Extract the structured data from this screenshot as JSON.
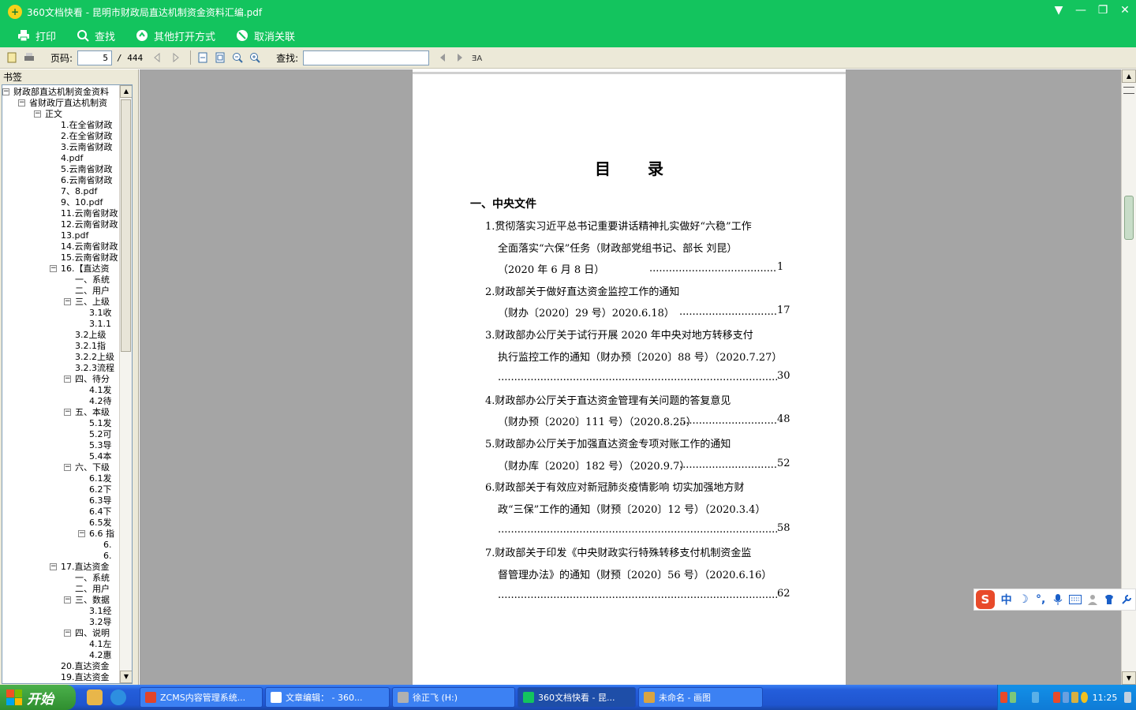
{
  "window": {
    "title": "360文档快看 - 昆明市财政局直达机制资金资料汇编.pdf",
    "controls": [
      "▼",
      "—",
      "❐",
      "✕"
    ]
  },
  "green_toolbar": {
    "print": "打印",
    "find": "查找",
    "open_with": "其他打开方式",
    "unlink": "取消关联"
  },
  "viewer_toolbar": {
    "page_label": "页码:",
    "page_current": "5",
    "page_total": "/ 444",
    "search_label": "查找:",
    "search_value": ""
  },
  "sidebar": {
    "header": "书签",
    "tree": [
      {
        "label": "财政部直达机制资金资料",
        "level": 0,
        "toggle": "−"
      },
      {
        "label": "省财政厅直达机制资",
        "level": 1,
        "toggle": "−"
      },
      {
        "label": "正文",
        "level": 2,
        "toggle": "−"
      },
      {
        "label": "1.在全省财政",
        "level": 3
      },
      {
        "label": "2.在全省财政",
        "level": 3
      },
      {
        "label": "3.云南省财政",
        "level": 3
      },
      {
        "label": "4.pdf",
        "level": 3
      },
      {
        "label": "5.云南省财政",
        "level": 3
      },
      {
        "label": "6.云南省财政",
        "level": 3
      },
      {
        "label": "7、8.pdf",
        "level": 3
      },
      {
        "label": "9、10.pdf",
        "level": 3
      },
      {
        "label": "11.云南省财政",
        "level": 3
      },
      {
        "label": "12.云南省财政",
        "level": 3
      },
      {
        "label": "13.pdf",
        "level": 3
      },
      {
        "label": "14.云南省财政",
        "level": 3
      },
      {
        "label": "15.云南省财政",
        "level": 3
      },
      {
        "label": "16.【直达资",
        "level": 3,
        "toggle": "−"
      },
      {
        "label": "一、系统",
        "level": 4
      },
      {
        "label": "二、用户",
        "level": 4
      },
      {
        "label": "三、上级",
        "level": 4,
        "toggle": "−"
      },
      {
        "label": "3.1收",
        "level": 5
      },
      {
        "label": "3.1.1",
        "level": 5
      },
      {
        "label": "3.2上级",
        "level": 4
      },
      {
        "label": "3.2.1指",
        "level": 4
      },
      {
        "label": "3.2.2上级",
        "level": 4
      },
      {
        "label": "3.2.3流程",
        "level": 4
      },
      {
        "label": "四、待分",
        "level": 4,
        "toggle": "−"
      },
      {
        "label": "4.1发",
        "level": 5
      },
      {
        "label": "4.2待",
        "level": 5
      },
      {
        "label": "五、本级",
        "level": 4,
        "toggle": "−"
      },
      {
        "label": "5.1发",
        "level": 5
      },
      {
        "label": "5.2可",
        "level": 5
      },
      {
        "label": "5.3导",
        "level": 5
      },
      {
        "label": "5.4本",
        "level": 5
      },
      {
        "label": "六、下级",
        "level": 4,
        "toggle": "−"
      },
      {
        "label": "6.1发",
        "level": 5
      },
      {
        "label": "6.2下",
        "level": 5
      },
      {
        "label": "6.3导",
        "level": 5
      },
      {
        "label": "6.4下",
        "level": 5
      },
      {
        "label": "6.5发",
        "level": 5
      },
      {
        "label": "6.6 指",
        "level": 5,
        "toggle": "−"
      },
      {
        "label": "6.",
        "level": 6
      },
      {
        "label": "6.",
        "level": 6
      },
      {
        "label": "17.直达资金",
        "level": 3,
        "toggle": "−"
      },
      {
        "label": "一、系统",
        "level": 4
      },
      {
        "label": "二、用户",
        "level": 4
      },
      {
        "label": "三、数据",
        "level": 4,
        "toggle": "−"
      },
      {
        "label": "3.1经",
        "level": 5
      },
      {
        "label": "3.2导",
        "level": 5
      },
      {
        "label": "四、说明",
        "level": 4,
        "toggle": "−"
      },
      {
        "label": "4.1左",
        "level": 5
      },
      {
        "label": "4.2惠",
        "level": 5
      },
      {
        "label": "20.直达资金",
        "level": 3
      },
      {
        "label": "19.直达资金",
        "level": 3
      }
    ]
  },
  "document": {
    "toc_title": "目 录",
    "section": "一、中央文件",
    "lines": [
      {
        "text": "1.贯彻落实习近平总书记重要讲话精神扎实做好“六稳”工作",
        "indent": 0
      },
      {
        "text": "全面落实“六保”任务（财政部党组书记、部长  刘昆）",
        "indent": 1
      },
      {
        "text": "（2020 年 6 月 8 日）",
        "indent": 1,
        "page": "1"
      },
      {
        "text": "2.财政部关于做好直达资金监控工作的通知",
        "indent": 0
      },
      {
        "text": "（财办〔2020〕29 号）2020.6.18）",
        "indent": 1,
        "page": "17"
      },
      {
        "text": "3.财政部办公厅关于试行开展 2020 年中央对地方转移支付",
        "indent": 0
      },
      {
        "text": "执行监控工作的通知（财办预〔2020〕88 号）（2020.7.27）",
        "indent": 1
      },
      {
        "text": "",
        "indent": 1,
        "page": "30"
      },
      {
        "text": "4.财政部办公厅关于直达资金管理有关问题的答复意见",
        "indent": 0
      },
      {
        "text": "（财办预〔2020〕111 号）（2020.8.25）",
        "indent": 1,
        "page": "48"
      },
      {
        "text": "5.财政部办公厅关于加强直达资金专项对账工作的通知",
        "indent": 0
      },
      {
        "text": "（财办库〔2020〕182 号）（2020.9.7）",
        "indent": 1,
        "page": "52"
      },
      {
        "text": "6.财政部关于有效应对新冠肺炎疫情影响  切实加强地方财",
        "indent": 0
      },
      {
        "text": "政“三保”工作的通知（财预〔2020〕12 号）（2020.3.4）",
        "indent": 1
      },
      {
        "text": "",
        "indent": 1,
        "page": "58"
      },
      {
        "text": "7.财政部关于印发《中央财政实行特殊转移支付机制资金监",
        "indent": 0
      },
      {
        "text": "督管理办法》的通知（财预〔2020〕56 号）（2020.6.16）",
        "indent": 1
      },
      {
        "text": "",
        "indent": 1,
        "page": "62"
      }
    ]
  },
  "ime": {
    "logo": "S",
    "icons": [
      "中",
      "☽",
      "°,",
      "🎤",
      "⌨",
      "👤",
      "👕",
      "🔧"
    ]
  },
  "taskbar": {
    "start": "开始",
    "tasks": [
      {
        "label": "ZCMS内容管理系统...",
        "color": "#e0442b",
        "active": false
      },
      {
        "label": "文章编辑： - 360...",
        "color": "#ffffff",
        "active": false
      },
      {
        "label": "徐正飞 (H:)",
        "color": "#b0b0b0",
        "active": false
      },
      {
        "label": "360文档快看 - 昆...",
        "color": "#13c45e",
        "active": true
      },
      {
        "label": "未命名 - 画图",
        "color": "#d9a441",
        "active": false
      }
    ],
    "clock": "11:25"
  },
  "colors": {
    "brand_green": "#13c45e",
    "taskbar_blue": "#245edb",
    "page_bg": "#a5a5a5"
  }
}
